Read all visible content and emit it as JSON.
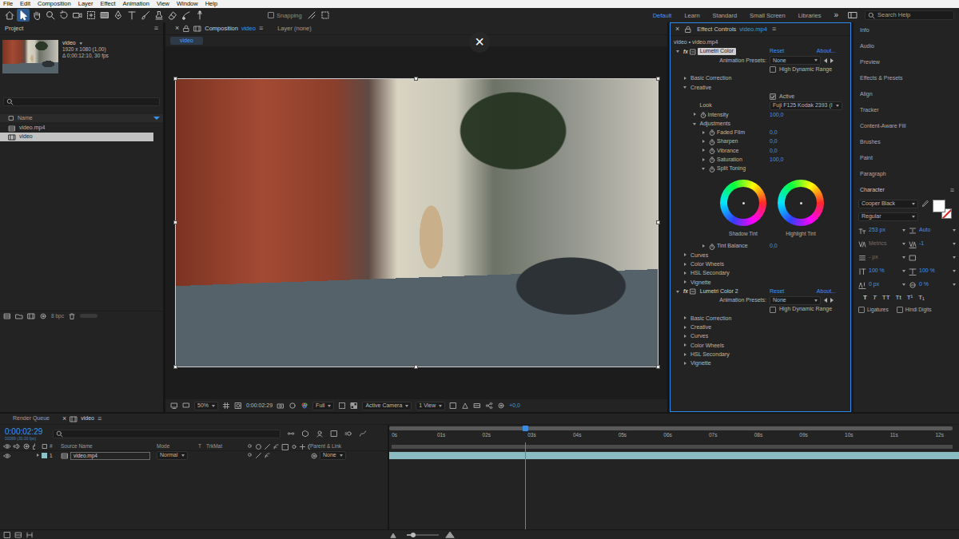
{
  "menu_bar": {
    "items": [
      "File",
      "Edit",
      "Composition",
      "Layer",
      "Effect",
      "Animation",
      "View",
      "Window",
      "Help"
    ]
  },
  "toolbar": {
    "tools": [
      {
        "selected": false
      },
      {
        "selected": true
      },
      {
        "selected": false
      },
      {
        "selected": false
      },
      {
        "selected": false
      },
      {
        "selected": false
      },
      {
        "selected": false
      },
      {
        "selected": false
      },
      {
        "selected": false
      },
      {
        "selected": false
      },
      {
        "selected": false
      },
      {
        "selected": false
      },
      {
        "selected": false
      },
      {
        "selected": false
      },
      {
        "selected": false
      }
    ],
    "snapping": {
      "label": "Snapping",
      "checked": false
    },
    "workspaces": [
      {
        "label": "Default",
        "selected": true
      },
      {
        "label": "Learn",
        "selected": false
      },
      {
        "label": "Standard",
        "selected": false
      },
      {
        "label": "Small Screen",
        "selected": false
      },
      {
        "label": "Libraries",
        "selected": false
      }
    ],
    "overflow": "»",
    "search": {
      "placeholder": "Search Help"
    }
  },
  "project": {
    "title": "Project",
    "menu": "≡",
    "footage": {
      "name": "video",
      "arrow": "▼",
      "size": "1920 x 1080 (1,00)",
      "duration": "Δ 0;00:12:10, 30 fps"
    },
    "column": "Name",
    "items": [
      {
        "name": "video.mp4",
        "kind": "footage",
        "selected": false
      },
      {
        "name": "video",
        "kind": "composition",
        "selected": true
      }
    ],
    "bit_depth": "8 bpc"
  },
  "composition": {
    "tabs": [
      {
        "close": "×",
        "label": "Composition",
        "target": "video",
        "selected": true
      },
      {
        "label": "Layer (none)",
        "selected": false
      }
    ],
    "menu": "≡",
    "breadcrumb": "video",
    "close_overlay": "×",
    "viewer_bar": {
      "zoom": "50%",
      "time": "0:00:02:29",
      "resolution": "Full",
      "camera": "Active Camera",
      "views": "1 View",
      "exposure": "+0,0"
    }
  },
  "effect_controls": {
    "close": "×",
    "title": "Effect Controls",
    "target": "video.mp4",
    "menu": "≡",
    "breadcrumb": "video • video.mp4",
    "effects": [
      {
        "fx": "fx",
        "name": "Lumetri Color",
        "selected": true,
        "expanded": true,
        "reset": "Reset",
        "about": "About...",
        "presets": {
          "label": "Animation Presets:",
          "value": "None"
        },
        "hdr": {
          "label": "High Dynamic Range",
          "checked": false
        },
        "rows": [
          {
            "kind": "group",
            "label": "Basic Correction",
            "expanded": false,
            "depth": 0
          },
          {
            "kind": "group",
            "label": "Creative",
            "expanded": true,
            "depth": 0
          },
          {
            "kind": "checkbox",
            "label": "Active",
            "checked": true,
            "depth": 1
          },
          {
            "kind": "dropdown",
            "label": "Look",
            "value": "Fuji F125 Kodak 2393 (I",
            "depth": 1
          },
          {
            "kind": "param",
            "label": "Intensity",
            "value": "100,0",
            "expanded": false,
            "depth": 1
          },
          {
            "kind": "group",
            "label": "Adjustments",
            "expanded": true,
            "depth": 1
          },
          {
            "kind": "param",
            "label": "Faded Film",
            "value": "0,0",
            "expanded": false,
            "depth": 2
          },
          {
            "kind": "param",
            "label": "Sharpen",
            "value": "0,0",
            "expanded": false,
            "depth": 2
          },
          {
            "kind": "param",
            "label": "Vibrance",
            "value": "0,0",
            "expanded": false,
            "depth": 2
          },
          {
            "kind": "param",
            "label": "Saturation",
            "value": "100,0",
            "expanded": false,
            "depth": 2
          },
          {
            "kind": "group",
            "label": "Split Toning",
            "expanded": true,
            "stopwatch": true,
            "depth": 2
          },
          {
            "kind": "wheels",
            "wheels": [
              {
                "label": "Shadow Tint"
              },
              {
                "label": "Highlight Tint"
              }
            ]
          },
          {
            "kind": "param",
            "label": "Tint Balance",
            "value": "0,0",
            "expanded": false,
            "depth": 2
          },
          {
            "kind": "group",
            "label": "Curves",
            "expanded": false,
            "depth": 0
          },
          {
            "kind": "group",
            "label": "Color Wheels",
            "expanded": false,
            "depth": 0
          },
          {
            "kind": "group",
            "label": "HSL Secondary",
            "expanded": false,
            "depth": 0
          },
          {
            "kind": "group",
            "label": "Vignette",
            "expanded": false,
            "depth": 0
          }
        ]
      },
      {
        "fx": "fx",
        "name": "Lumetri Color 2",
        "selected": false,
        "expanded": true,
        "reset": "Reset",
        "about": "About...",
        "presets": {
          "label": "Animation Presets:",
          "value": "None"
        },
        "hdr": {
          "label": "High Dynamic Range",
          "checked": false
        },
        "rows": [
          {
            "kind": "group",
            "label": "Basic Correction",
            "expanded": false,
            "depth": 0
          },
          {
            "kind": "group",
            "label": "Creative",
            "expanded": false,
            "depth": 0
          },
          {
            "kind": "group",
            "label": "Curves",
            "expanded": false,
            "depth": 0
          },
          {
            "kind": "group",
            "label": "Color Wheels",
            "expanded": false,
            "depth": 0
          },
          {
            "kind": "group",
            "label": "HSL Secondary",
            "expanded": false,
            "depth": 0
          },
          {
            "kind": "group",
            "label": "Vignette",
            "expanded": false,
            "depth": 0
          }
        ]
      }
    ]
  },
  "panels": {
    "items": [
      "Info",
      "Audio",
      "Preview",
      "Effects & Presets",
      "Align",
      "Tracker",
      "Content-Aware Fill",
      "Brushes",
      "Paint",
      "Paragraph"
    ]
  },
  "character": {
    "title": "Character",
    "menu": "≡",
    "font": "Cooper Black",
    "style": "Regular",
    "fill_color": "#ffffff",
    "stroke_none": true,
    "fields": [
      {
        "value": "253 px",
        "disabled": false
      },
      {
        "value": "Auto",
        "disabled": false
      },
      {
        "value": "Metrics",
        "disabled": true
      },
      {
        "value": "-1",
        "disabled": false
      },
      {
        "value": "- px",
        "disabled": true
      },
      {
        "value": "",
        "disabled": false
      },
      {
        "value": "100 %",
        "disabled": false
      },
      {
        "value": "100 %",
        "disabled": false
      },
      {
        "value": "0 px",
        "disabled": false
      },
      {
        "value": "0 %",
        "disabled": false
      }
    ],
    "styles": [
      "T",
      "T",
      "TT",
      "Tt",
      "T¹",
      "T₁"
    ],
    "options": [
      {
        "label": "Ligatures",
        "checked": false
      },
      {
        "label": "Hindi Digits",
        "checked": false
      }
    ]
  },
  "timeline": {
    "tabs": [
      {
        "label": "Render Queue",
        "selected": false
      },
      {
        "close": "×",
        "label": "video",
        "selected": true
      }
    ],
    "menu": "≡",
    "timecode": "0:00:02:29",
    "frame_info": "00089 (30.00 fps)",
    "columns": [
      "#",
      "Source Name",
      "Mode",
      "T",
      "TrkMat",
      "Parent & Link"
    ],
    "layers": [
      {
        "visible": true,
        "expanded": false,
        "color": "#8fc1c9",
        "number": "1",
        "name": "video.mp4",
        "mode": "Normal",
        "parent": "None",
        "level": 1
      }
    ],
    "ruler": [
      "0s",
      "01s",
      "02s",
      "03s",
      "04s",
      "05s",
      "06s",
      "07s",
      "08s",
      "09s",
      "10s",
      "11s",
      "12s"
    ],
    "playhead": {
      "level": 0.239
    },
    "zoom": {
      "level": 0.2
    }
  }
}
